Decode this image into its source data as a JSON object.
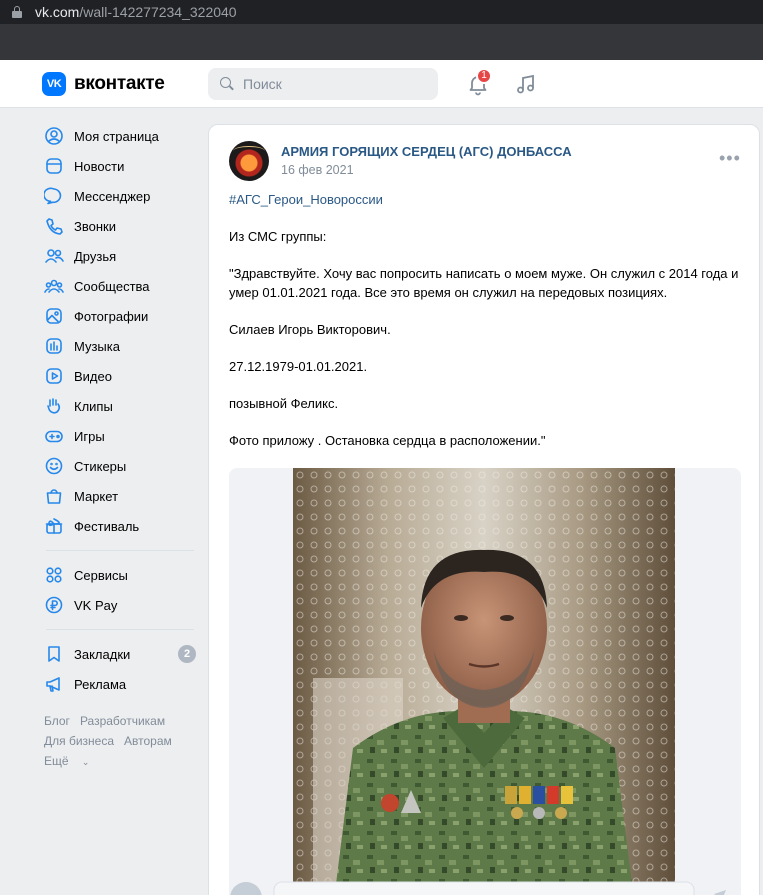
{
  "browser": {
    "url_host": "vk.com",
    "url_path": "/wall-142277234_322040"
  },
  "header": {
    "logo_mark": "VK",
    "logo_text": "вконтакте",
    "search_placeholder": "Поиск",
    "notifications_count": "1"
  },
  "sidebar": {
    "items": [
      {
        "label": "Моя страница",
        "icon": "user-circle-icon"
      },
      {
        "label": "Новости",
        "icon": "newsfeed-icon"
      },
      {
        "label": "Мессенджер",
        "icon": "message-icon"
      },
      {
        "label": "Звонки",
        "icon": "phone-icon"
      },
      {
        "label": "Друзья",
        "icon": "friends-icon"
      },
      {
        "label": "Сообщества",
        "icon": "communities-icon"
      },
      {
        "label": "Фотографии",
        "icon": "photo-icon"
      },
      {
        "label": "Музыка",
        "icon": "music-icon"
      },
      {
        "label": "Видео",
        "icon": "video-icon"
      },
      {
        "label": "Клипы",
        "icon": "clips-icon"
      },
      {
        "label": "Игры",
        "icon": "gamepad-icon"
      },
      {
        "label": "Стикеры",
        "icon": "smile-icon"
      },
      {
        "label": "Маркет",
        "icon": "market-icon"
      },
      {
        "label": "Фестиваль",
        "icon": "gift-icon"
      }
    ],
    "items2": [
      {
        "label": "Сервисы",
        "icon": "services-icon"
      },
      {
        "label": "VK Pay",
        "icon": "vkpay-icon"
      }
    ],
    "items3": [
      {
        "label": "Закладки",
        "icon": "bookmark-icon",
        "count": "2"
      },
      {
        "label": "Реклама",
        "icon": "megaphone-icon"
      }
    ],
    "footer": {
      "blog": "Блог",
      "developers": "Разработчикам",
      "business": "Для бизнеса",
      "authors": "Авторам",
      "more": "Ещё"
    }
  },
  "post": {
    "author": "АРМИЯ ГОРЯЩИХ СЕРДЕЦ (АГС) ДОНБАССА",
    "date": "16 фев 2021",
    "hashtag": "#АГС_Герои_Новороссии",
    "lines": [
      "Из СМС группы:",
      "\"Здравствуйте. Хочу вас попросить написать о моем муже. Он служил с 2014 года и умер 01.01.2021 года. Все это время он служил на передовых позициях.",
      "Силаев Игорь Викторович.",
      "27.12.1979-01.01.2021.",
      "позывной Феликс.",
      "Фото приложу . Остановка сердца в расположении.\""
    ]
  },
  "colors": {
    "accent": "#0077ff",
    "link": "#2a5885",
    "background": "#edeef0",
    "badge": "#e64646"
  }
}
